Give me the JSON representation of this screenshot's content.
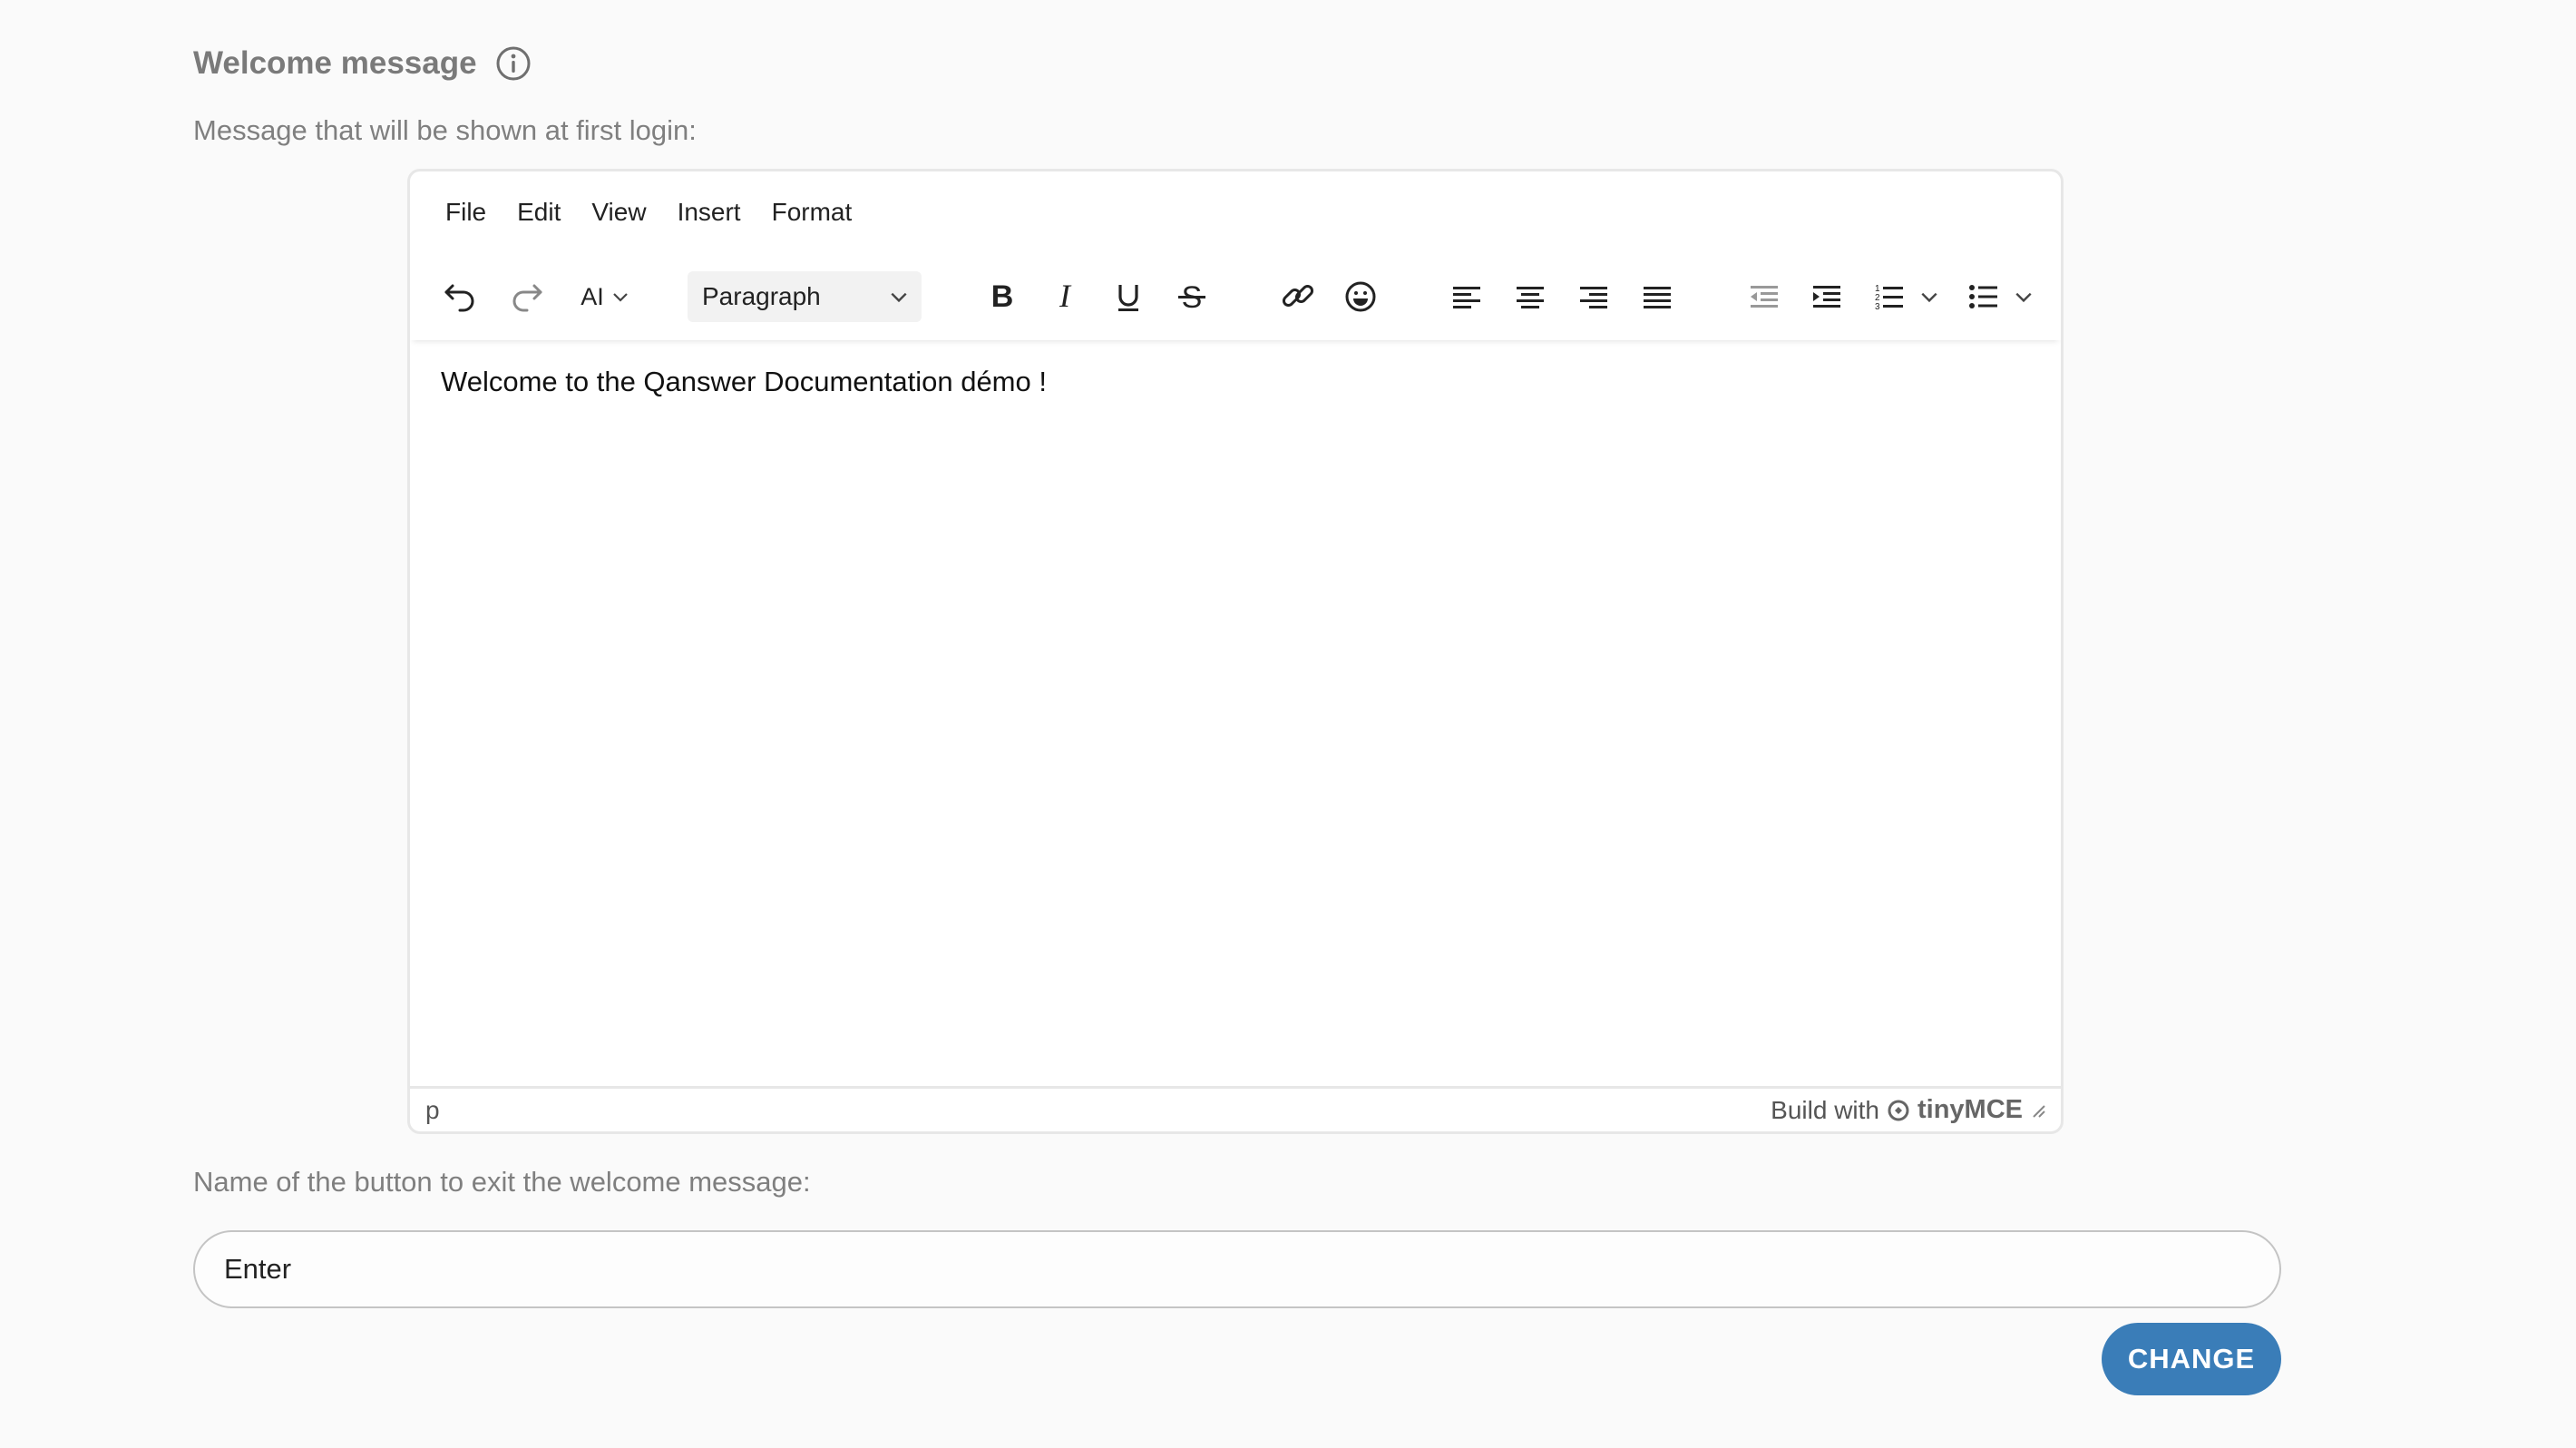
{
  "section": {
    "title": "Welcome message",
    "message_label": "Message that will be shown at first login:",
    "button_name_label": "Name of the button to exit the welcome message:"
  },
  "editor": {
    "menu": [
      "File",
      "Edit",
      "View",
      "Insert",
      "Format"
    ],
    "toolbar": {
      "ai_label": "AI",
      "block_format": "Paragraph"
    },
    "content": "Welcome to the Qanswer Documentation démo !",
    "status_path": "p",
    "branding_prefix": "Build with",
    "branding_name": "tinyMCE"
  },
  "button_name_input": {
    "value": "Enter"
  },
  "actions": {
    "change_label": "CHANGE"
  },
  "colors": {
    "primary": "#3a7db8",
    "muted_text": "#7f7f7f"
  }
}
